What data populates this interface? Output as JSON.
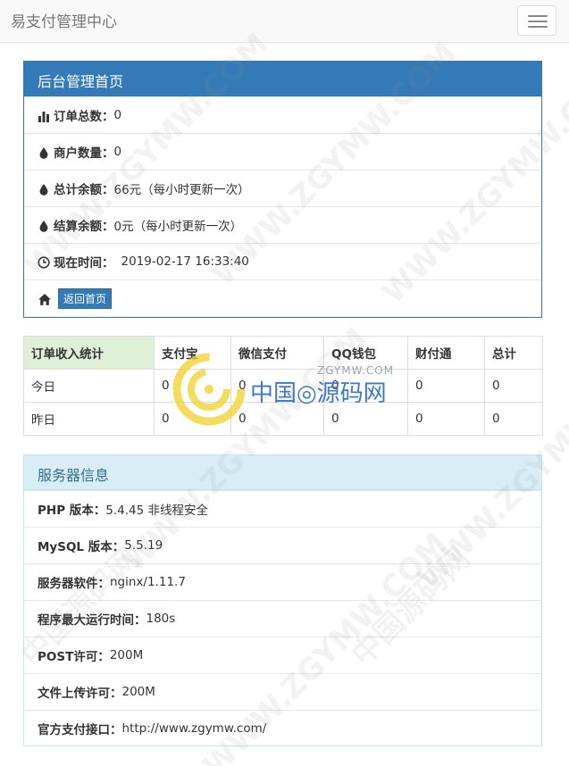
{
  "navbar": {
    "brand": "易支付管理中心"
  },
  "admin_panel": {
    "title": "后台管理首页",
    "rows": [
      {
        "icon": "bar-chart-icon",
        "label": "订单总数：",
        "value": "0"
      },
      {
        "icon": "droplet-icon",
        "label": "商户数量：",
        "value": "0"
      },
      {
        "icon": "droplet-icon",
        "label": "总计余额：",
        "value": "66元（每小时更新一次）"
      },
      {
        "icon": "droplet-icon",
        "label": "结算余额：",
        "value": "0元（每小时更新一次）"
      },
      {
        "icon": "clock-icon",
        "label": "现在时间：",
        "value": "2019-02-17 16:33:40"
      }
    ],
    "home_button": "返回首页"
  },
  "stats_table": {
    "headers": [
      "订单收入统计",
      "支付宝",
      "微信支付",
      "QQ钱包",
      "财付通",
      "总计"
    ],
    "rows": [
      [
        "今日",
        "0",
        "0",
        "0",
        "0",
        "0"
      ],
      [
        "昨日",
        "0",
        "0",
        "0",
        "0",
        "0"
      ]
    ]
  },
  "server_panel": {
    "title": "服务器信息",
    "rows": [
      {
        "label": "PHP 版本：",
        "value": "5.4.45 非线程安全"
      },
      {
        "label": "MySQL 版本：",
        "value": "5.5.19"
      },
      {
        "label": "服务器软件：",
        "value": "nginx/1.11.7"
      },
      {
        "label": "程序最大运行时间：",
        "value": "180s"
      },
      {
        "label": "POST许可：",
        "value": "200M"
      },
      {
        "label": "文件上传许可：",
        "value": "200M"
      },
      {
        "label": "官方支付接口：",
        "value": "http://www.zgymw.com/"
      }
    ]
  },
  "watermark": {
    "text": "WWW.ZGYMW.COM",
    "text_cn": "中国源码网",
    "logo_cn": "中国◎源码网",
    "logo_en": "ZGYMW.COM"
  },
  "colors": {
    "primary": "#337ab7",
    "info_bg": "#d9edf7",
    "info_text": "#31708f",
    "success_bg": "#dff0d8"
  }
}
